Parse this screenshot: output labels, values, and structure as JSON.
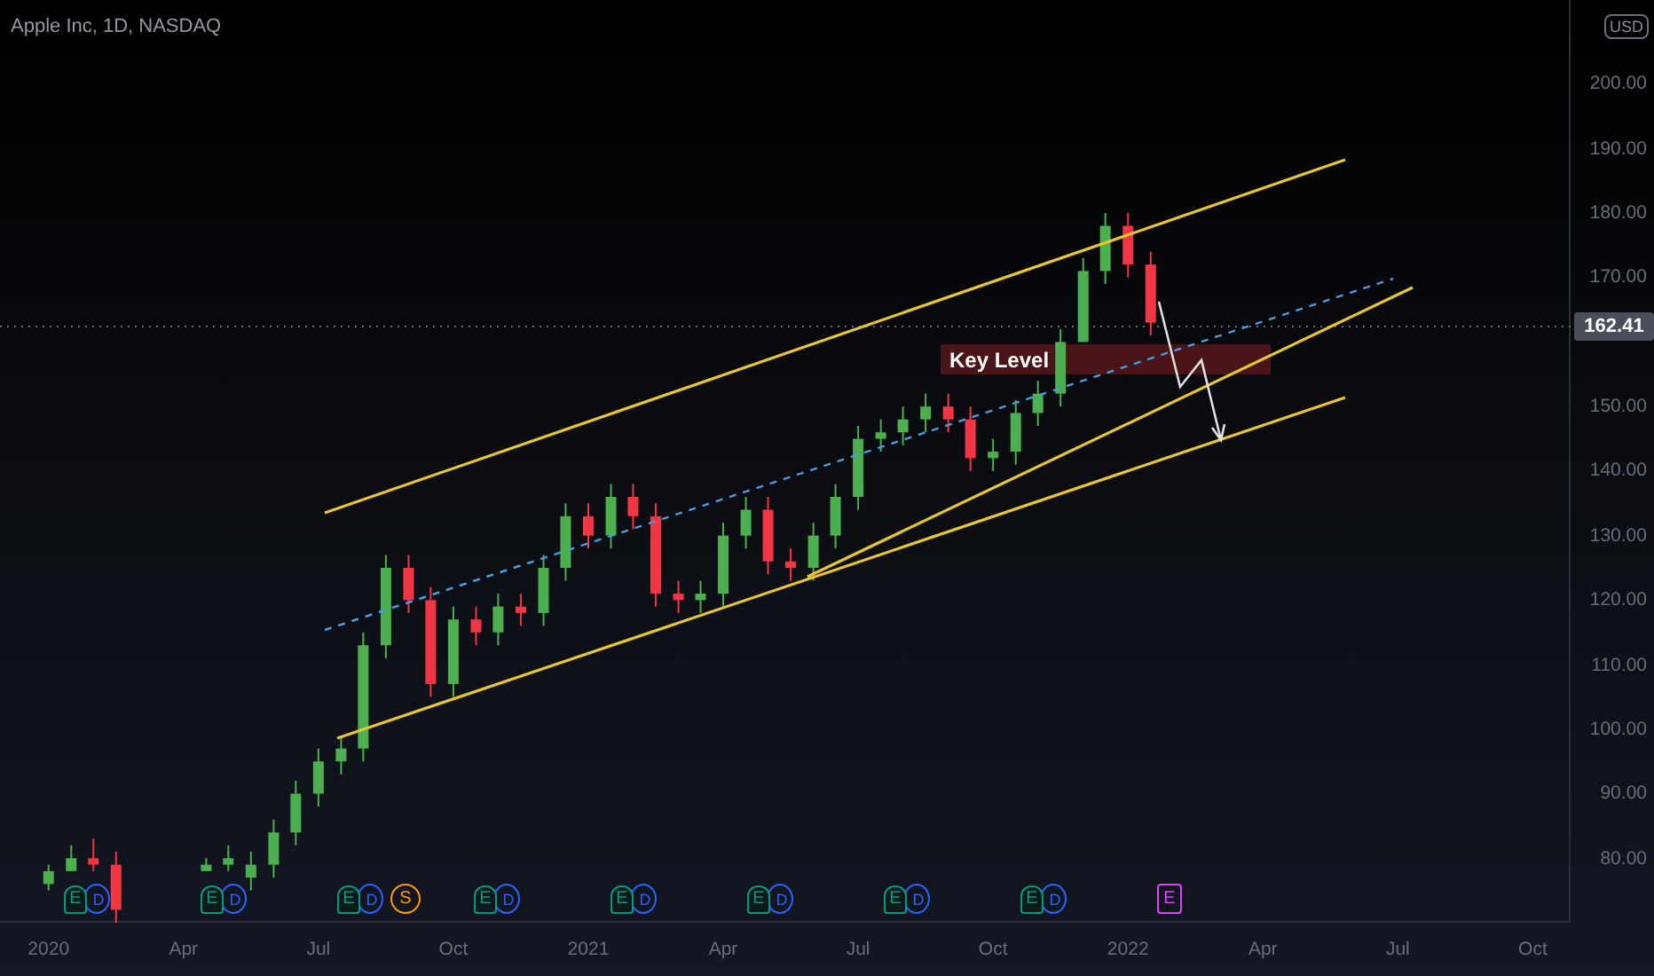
{
  "title": "Apple Inc, 1D, NASDAQ",
  "currency": "USD",
  "chart_data": {
    "type": "candlestick",
    "xlim": [
      2019.91,
      2022.82
    ],
    "ylim": [
      70,
      213
    ],
    "x": [
      2020.0,
      2020.042,
      2020.083,
      2020.125,
      2020.292,
      2020.333,
      2020.375,
      2020.417,
      2020.458,
      2020.5,
      2020.542,
      2020.583,
      2020.625,
      2020.667,
      2020.708,
      2020.75,
      2020.792,
      2020.833,
      2020.875,
      2020.917,
      2020.958,
      2021.0,
      2021.042,
      2021.083,
      2021.125,
      2021.167,
      2021.208,
      2021.25,
      2021.292,
      2021.333,
      2021.375,
      2021.417,
      2021.458,
      2021.5,
      2021.542,
      2021.583,
      2021.625,
      2021.667,
      2021.708,
      2021.75,
      2021.792,
      2021.833,
      2021.875,
      2021.917,
      2021.958,
      2022.0,
      2022.042
    ],
    "ohlc": [
      [
        76,
        79,
        75,
        78
      ],
      [
        78,
        82,
        78,
        80
      ],
      [
        80,
        83,
        78,
        79
      ],
      [
        79,
        81,
        70,
        72
      ],
      [
        78,
        80,
        78,
        79
      ],
      [
        79,
        82,
        78,
        80
      ],
      [
        77,
        81,
        75,
        79
      ],
      [
        79,
        86,
        77,
        84
      ],
      [
        84,
        92,
        82,
        90
      ],
      [
        90,
        97,
        88,
        95
      ],
      [
        95,
        99,
        93,
        97
      ],
      [
        97,
        115,
        95,
        113
      ],
      [
        113,
        127,
        111,
        125
      ],
      [
        125,
        127,
        118,
        120
      ],
      [
        120,
        122,
        105,
        107
      ],
      [
        107,
        119,
        105,
        117
      ],
      [
        117,
        119,
        113,
        115
      ],
      [
        115,
        121,
        113,
        119
      ],
      [
        119,
        121,
        116,
        118
      ],
      [
        118,
        127,
        116,
        125
      ],
      [
        125,
        135,
        123,
        133
      ],
      [
        133,
        135,
        128,
        130
      ],
      [
        130,
        138,
        128,
        136
      ],
      [
        136,
        138,
        131,
        133
      ],
      [
        133,
        135,
        119,
        121
      ],
      [
        121,
        123,
        118,
        120
      ],
      [
        120,
        123,
        118,
        121
      ],
      [
        121,
        132,
        119,
        130
      ],
      [
        130,
        136,
        128,
        134
      ],
      [
        134,
        136,
        124,
        126
      ],
      [
        126,
        128,
        123,
        125
      ],
      [
        125,
        132,
        123,
        130
      ],
      [
        130,
        138,
        128,
        136
      ],
      [
        136,
        147,
        134,
        145
      ],
      [
        145,
        148,
        143,
        146
      ],
      [
        146,
        150,
        144,
        148
      ],
      [
        148,
        152,
        146,
        150
      ],
      [
        150,
        152,
        146,
        148
      ],
      [
        148,
        150,
        140,
        142
      ],
      [
        142,
        145,
        140,
        143
      ],
      [
        143,
        151,
        141,
        149
      ],
      [
        149,
        154,
        147,
        152
      ],
      [
        152,
        162,
        150,
        160
      ],
      [
        160,
        173,
        160,
        171
      ],
      [
        171,
        180,
        169,
        178
      ],
      [
        178,
        180,
        170,
        172
      ],
      [
        172,
        174,
        161,
        163
      ]
    ],
    "xticks": [
      {
        "value": 2020,
        "label": "2020"
      },
      {
        "value": 2020.25,
        "label": "Apr"
      },
      {
        "value": 2020.5,
        "label": "Jul"
      },
      {
        "value": 2020.75,
        "label": "Oct"
      },
      {
        "value": 2021,
        "label": "2021"
      },
      {
        "value": 2021.25,
        "label": "Apr"
      },
      {
        "value": 2021.5,
        "label": "Jul"
      },
      {
        "value": 2021.75,
        "label": "Oct"
      },
      {
        "value": 2022,
        "label": "2022"
      },
      {
        "value": 2022.25,
        "label": "Apr"
      },
      {
        "value": 2022.5,
        "label": "Jul"
      },
      {
        "value": 2022.75,
        "label": "Oct"
      }
    ],
    "yticks": [
      {
        "value": 200,
        "label": "200.00"
      },
      {
        "value": 190,
        "label": "190.00"
      },
      {
        "value": 180,
        "label": "180.00"
      },
      {
        "value": 170,
        "label": "170.00"
      },
      {
        "value": 150,
        "label": "150.00"
      },
      {
        "value": 140,
        "label": "140.00"
      },
      {
        "value": 130,
        "label": "130.00"
      },
      {
        "value": 120,
        "label": "120.00"
      },
      {
        "value": 110,
        "label": "110.00"
      },
      {
        "value": 100,
        "label": "100.00"
      },
      {
        "value": 90,
        "label": "90.00"
      },
      {
        "value": 80,
        "label": "80.00"
      }
    ],
    "ref_lines": [
      {
        "axis": "y",
        "value": 162.41,
        "label": "162.41"
      }
    ],
    "annotations": [
      {
        "text": "Key Level"
      }
    ]
  },
  "events": [
    {
      "kind": "earnings_dividend",
      "labels": [
        "E",
        "D"
      ]
    },
    {
      "kind": "earnings_dividend",
      "labels": [
        "E",
        "D"
      ]
    },
    {
      "kind": "earnings_dividend",
      "labels": [
        "E",
        "D"
      ]
    },
    {
      "kind": "split",
      "labels": [
        "S"
      ]
    },
    {
      "kind": "earnings_dividend",
      "labels": [
        "E",
        "D"
      ]
    },
    {
      "kind": "earnings_dividend",
      "labels": [
        "E",
        "D"
      ]
    },
    {
      "kind": "earnings_dividend",
      "labels": [
        "E",
        "D"
      ]
    },
    {
      "kind": "earnings_dividend",
      "labels": [
        "E",
        "D"
      ]
    },
    {
      "kind": "earnings_dividend",
      "labels": [
        "E",
        "D"
      ]
    },
    {
      "kind": "earnings",
      "labels": [
        "E"
      ]
    }
  ]
}
